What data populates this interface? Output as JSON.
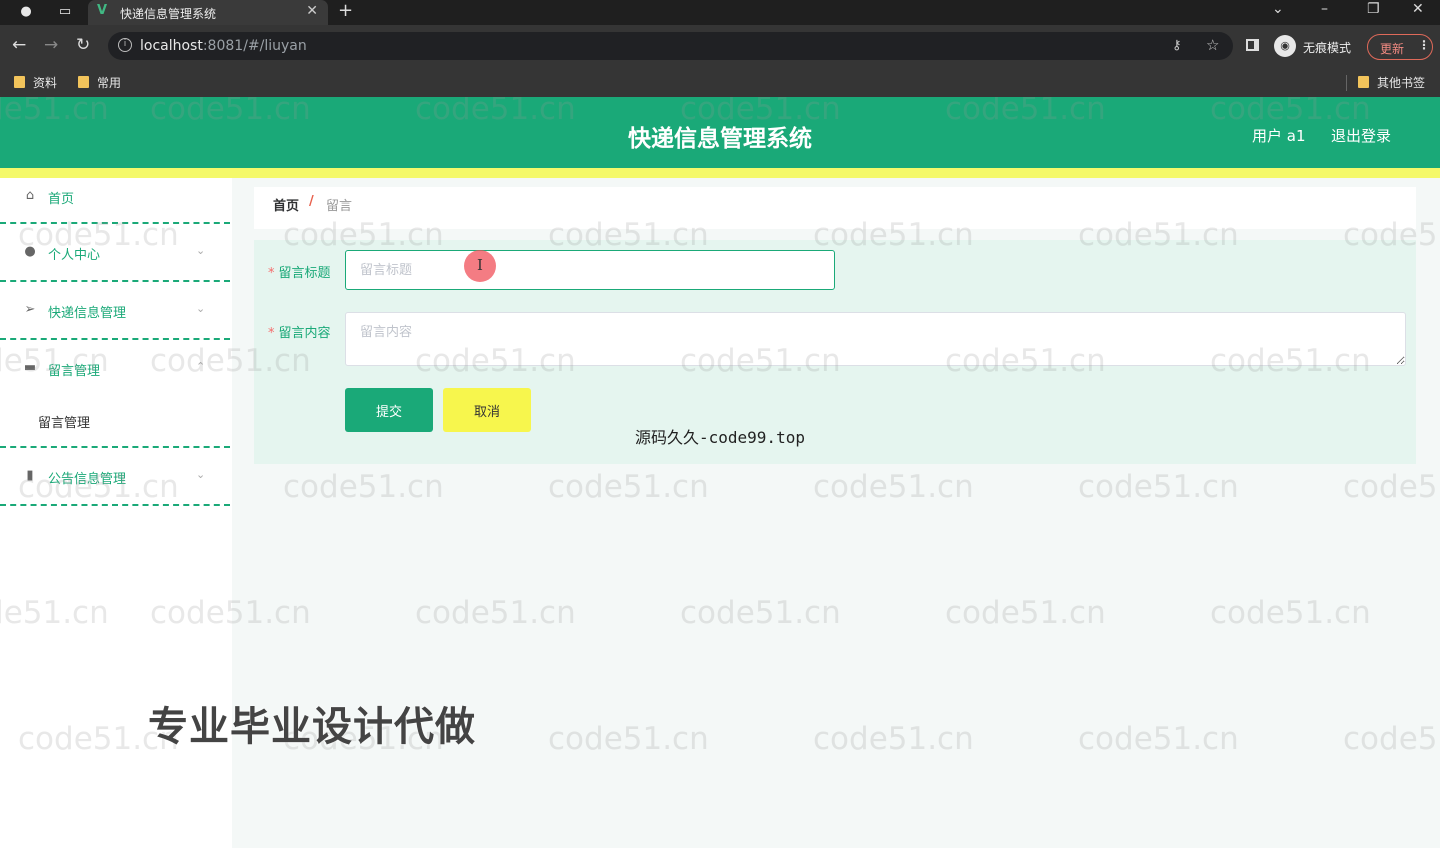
{
  "browser": {
    "tab_title": "快递信息管理系统",
    "url_host": "localhost",
    "url_rest": ":8081/#/liuyan",
    "incognito_label": "无痕模式",
    "update_label": "更新",
    "bookmarks": [
      "资料",
      "常用"
    ],
    "other_bookmarks": "其他书签"
  },
  "header": {
    "title": "快递信息管理系统",
    "user": "用户 a1",
    "logout": "退出登录",
    "primary_color": "#1aa978",
    "stripe_color": "#f4f96a"
  },
  "sidebar": {
    "items": [
      {
        "label": "首页",
        "icon": "home-icon"
      },
      {
        "label": "个人中心",
        "icon": "user-icon"
      },
      {
        "label": "快递信息管理",
        "icon": "send-icon"
      },
      {
        "label": "留言管理",
        "icon": "chat-icon",
        "sub": "留言管理"
      },
      {
        "label": "公告信息管理",
        "icon": "notice-icon"
      }
    ]
  },
  "breadcrumb": {
    "home": "首页",
    "separator": "/",
    "current": "留言"
  },
  "form": {
    "title_label": "留言标题",
    "title_placeholder": "留言标题",
    "title_value": "",
    "content_label": "留言内容",
    "content_placeholder": "留言内容",
    "content_value": "",
    "required_mark": "*",
    "submit_label": "提交",
    "cancel_label": "取消"
  },
  "overlay": {
    "watermark": "code51.cn",
    "source_text": "源码久久-code99.top",
    "promo_text": "专业毕业设计代做"
  }
}
